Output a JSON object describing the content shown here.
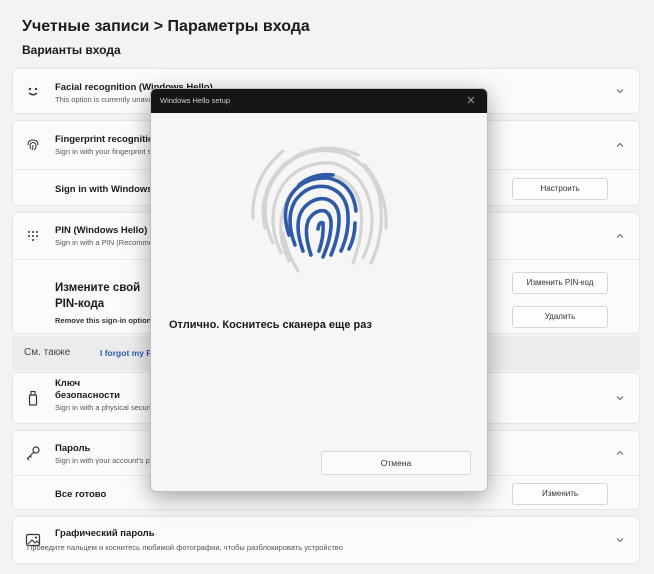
{
  "header": {
    "breadcrumb": "Учетные записи > Параметры входа",
    "section_title": "Варианты входа"
  },
  "options": {
    "facial": {
      "title": "Facial recognition (Windows Hello)",
      "subtitle": "This option is currently unavailable",
      "icon": "smiley-icon"
    },
    "fingerprint": {
      "title": "Fingerprint recognition (Windows Hello)",
      "subtitle": "Sign in with your fingerprint scanner",
      "icon": "fingerprint-icon",
      "sub_label": "Sign in with Windows Hello",
      "sub_button": "Настроить"
    },
    "pin": {
      "title": "PIN (Windows Hello)",
      "subtitle": "Sign in with a PIN (Recommended)",
      "icon": "keypad-icon",
      "change_title_1": "Измените свой",
      "change_title_2": "PIN-кода",
      "remove_sub": "Remove this sign-in option",
      "change_button": "Изменить PIN-код",
      "remove_button": "Удалить"
    },
    "seealso": {
      "label": "См. также",
      "link": "I forgot my PIN"
    },
    "security_key": {
      "title_1": "Ключ",
      "title_2": "безопасности",
      "subtitle": "Sign in with a physical security key",
      "icon": "usb-key-icon"
    },
    "password": {
      "title": "Пароль",
      "subtitle": "Sign in with your account's password",
      "icon": "key-icon",
      "sub_label": "Все готово",
      "sub_button": "Изменить"
    },
    "picture": {
      "title": "Графический пароль",
      "subtitle": "Проведите пальцем и коснитесь любимой фотографии, чтобы разблокировать устройство",
      "icon": "picture-icon"
    }
  },
  "dialog": {
    "title": "Windows Hello setup",
    "message": "Отлично. Коснитесь сканера еще раз",
    "cancel": "Отмена",
    "fingerprint_color": "#2f5aa8"
  }
}
